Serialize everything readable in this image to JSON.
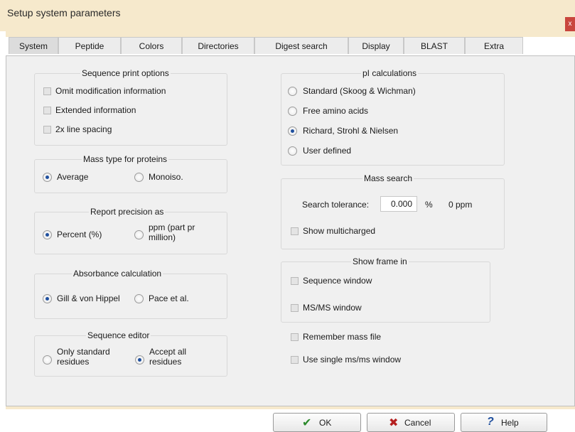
{
  "window": {
    "title": "Setup system parameters",
    "close_glyph": "x"
  },
  "tabs": [
    {
      "label": "System"
    },
    {
      "label": "Peptide"
    },
    {
      "label": "Colors"
    },
    {
      "label": "Directories"
    },
    {
      "label": "Digest search"
    },
    {
      "label": "Display"
    },
    {
      "label": "BLAST"
    },
    {
      "label": "Extra"
    }
  ],
  "sequence_print": {
    "title": "Sequence print options",
    "options": [
      "Omit modification information",
      "Extended information",
      "2x line spacing"
    ]
  },
  "mass_type": {
    "title": "Mass type for proteins",
    "average": "Average",
    "monoiso": "Monoiso."
  },
  "report_precision": {
    "title": "Report precision as",
    "percent": "Percent (%)",
    "ppm_line1": "ppm (part pr",
    "ppm_line2": "million)"
  },
  "absorbance": {
    "title": "Absorbance calculation",
    "gill": "Gill & von Hippel",
    "pace": "Pace et al."
  },
  "sequence_editor": {
    "title": "Sequence editor",
    "only_line1": "Only standard",
    "only_line2": "residues",
    "accept_line1": "Accept all",
    "accept_line2": "residues"
  },
  "pi_calc": {
    "title": "pI calculations",
    "options": [
      "Standard (Skoog & Wichman)",
      "Free amino acids",
      "Richard, Strohl & Nielsen",
      "User defined"
    ],
    "selected_index": 2
  },
  "mass_search": {
    "title": "Mass search",
    "tolerance_label": "Search tolerance:",
    "tolerance_value": "0.000",
    "percent_sign": "%",
    "ppm_text": "0 ppm",
    "multicharged": "Show multicharged"
  },
  "show_frame": {
    "title": "Show frame in",
    "sequence": "Sequence window",
    "msms": "MS/MS window"
  },
  "extra_options": {
    "remember": "Remember mass file",
    "single": "Use single ms/ms window"
  },
  "buttons": {
    "ok": "OK",
    "cancel": "Cancel",
    "help": "Help",
    "ok_icon_glyph": "✔",
    "cancel_icon_glyph": "✖",
    "help_icon_glyph": "?"
  },
  "colors": {
    "frame_bg": "#f6e9cc",
    "radio_dot": "#1f4f9e",
    "ok_green": "#2c8a2c",
    "cancel_red": "#b52020",
    "help_blue": "#1f4f9e"
  }
}
